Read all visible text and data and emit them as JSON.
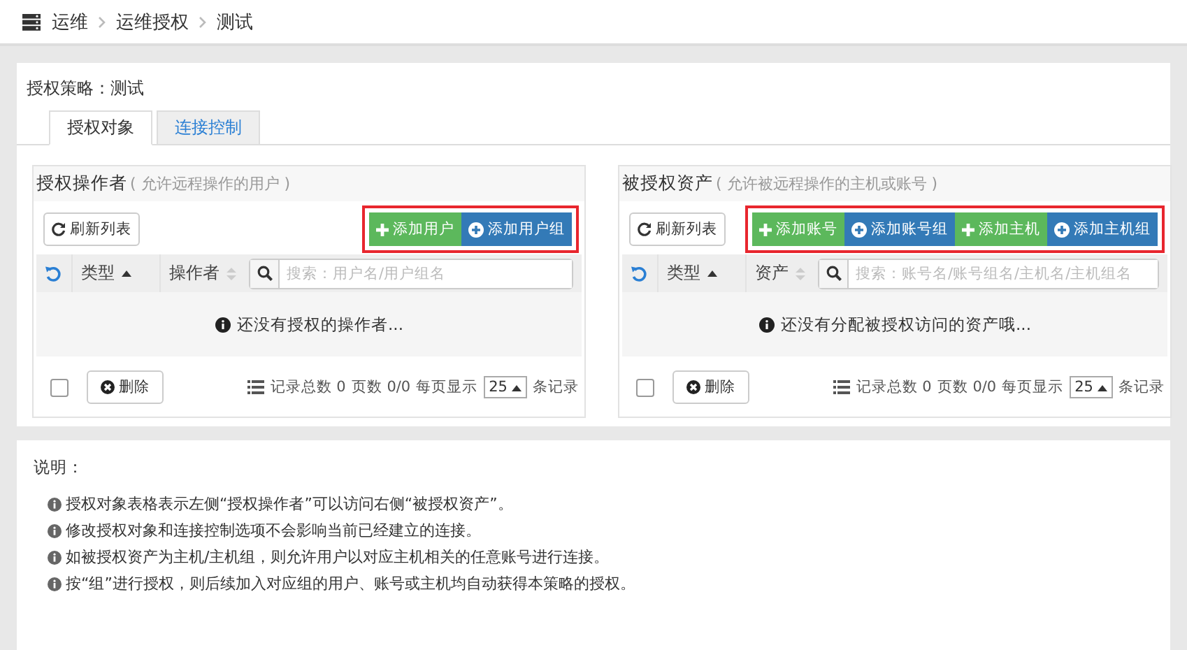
{
  "breadcrumb": [
    "运维",
    "运维授权",
    "测试"
  ],
  "policy_title": "授权策略：测试",
  "tabs": [
    {
      "label": "授权对象",
      "selected": true
    },
    {
      "label": "连接控制",
      "selected": false
    }
  ],
  "panels": [
    {
      "title": "授权操作者",
      "subtitle": "( 允许远程操作的用户 )",
      "refresh": "刷新列表",
      "highlighted": true,
      "buttons": [
        {
          "label": "添加用户",
          "kind": "add"
        },
        {
          "label": "添加用户组",
          "kind": "add-group"
        }
      ],
      "columns": [
        {
          "label": "类型",
          "sorted": true
        },
        {
          "label": "操作者",
          "sorted": false
        }
      ],
      "search_placeholder": "搜索：用户名/用户组名",
      "empty": "还没有授权的操作者...",
      "select_all_checked": false,
      "delete": "删除",
      "total": "记录总数 0",
      "pages": "页数 0/0",
      "per_page_label": "每页显示",
      "per_page": "25",
      "per_page_suffix": "条记录"
    },
    {
      "title": "被授权资产",
      "subtitle": "( 允许被远程操作的主机或账号 )",
      "refresh": "刷新列表",
      "highlighted": true,
      "buttons": [
        {
          "label": "添加账号",
          "kind": "add"
        },
        {
          "label": "添加账号组",
          "kind": "add-group"
        },
        {
          "label": "添加主机",
          "kind": "add"
        },
        {
          "label": "添加主机组",
          "kind": "add-group"
        }
      ],
      "columns": [
        {
          "label": "类型",
          "sorted": true
        },
        {
          "label": "资产",
          "sorted": false
        }
      ],
      "search_placeholder": "搜索：账号名/账号组名/主机名/主机组名",
      "empty": "还没有分配被授权访问的资产哦...",
      "select_all_checked": false,
      "delete": "删除",
      "total": "记录总数 0",
      "pages": "页数 0/0",
      "per_page_label": "每页显示",
      "per_page": "25",
      "per_page_suffix": "条记录"
    }
  ],
  "notes": {
    "title": "说明：",
    "items": [
      "授权对象表格表示左侧“授权操作者”可以访问右侧“被授权资产”。",
      "修改授权对象和连接控制选项不会影响当前已经建立的连接。",
      "如被授权资产为主机/主机组，则允许用户以对应主机相关的任意账号进行连接。",
      "按“组”进行授权，则后续加入对应组的用户、账号或主机均自动获得本策略的授权。"
    ]
  }
}
